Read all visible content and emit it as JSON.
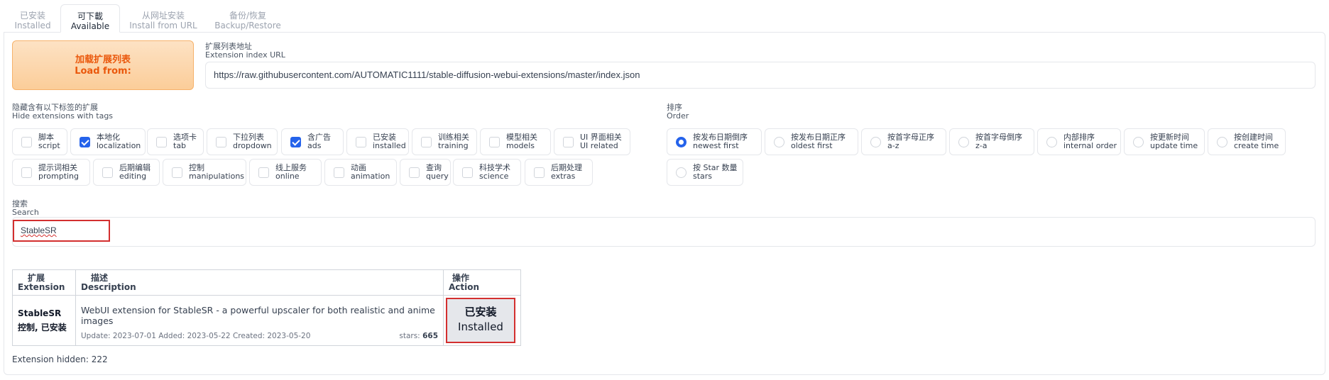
{
  "tabs": [
    {
      "zh": "已安装",
      "en": "Installed"
    },
    {
      "zh": "可下載",
      "en": "Available"
    },
    {
      "zh": "从网址安装",
      "en": "Install from URL"
    },
    {
      "zh": "备份/恢复",
      "en": "Backup/Restore"
    }
  ],
  "load_button": {
    "zh": "加载扩展列表",
    "en": "Load from:"
  },
  "index_url": {
    "label_zh": "扩展列表地址",
    "label_en": "Extension index URL",
    "value": "https://raw.githubusercontent.com/AUTOMATIC1111/stable-diffusion-webui-extensions/master/index.json"
  },
  "hide_tags": {
    "label_zh": "隐藏含有以下标签的扩展",
    "label_en": "Hide extensions with tags",
    "items": [
      {
        "zh": "脚本",
        "en": "script",
        "checked": false
      },
      {
        "zh": "本地化",
        "en": "localization",
        "checked": true
      },
      {
        "zh": "选项卡",
        "en": "tab",
        "checked": false
      },
      {
        "zh": "下拉列表",
        "en": "dropdown",
        "checked": false
      },
      {
        "zh": "含广告",
        "en": "ads",
        "checked": true
      },
      {
        "zh": "已安装",
        "en": "installed",
        "checked": false
      },
      {
        "zh": "训练相关",
        "en": "training",
        "checked": false
      },
      {
        "zh": "模型相关",
        "en": "models",
        "checked": false
      },
      {
        "zh": "UI 界面相关",
        "en": "UI related",
        "checked": false
      },
      {
        "zh": "提示词相关",
        "en": "prompting",
        "checked": false
      },
      {
        "zh": "后期编辑",
        "en": "editing",
        "checked": false
      },
      {
        "zh": "控制",
        "en": "manipulations",
        "checked": false
      },
      {
        "zh": "线上服务",
        "en": "online",
        "checked": false
      },
      {
        "zh": "动画",
        "en": "animation",
        "checked": false
      },
      {
        "zh": "查询",
        "en": "query",
        "checked": false
      },
      {
        "zh": "科技学术",
        "en": "science",
        "checked": false
      },
      {
        "zh": "后期处理",
        "en": "extras",
        "checked": false
      }
    ]
  },
  "order": {
    "label_zh": "排序",
    "label_en": "Order",
    "items": [
      {
        "zh": "按发布日期倒序",
        "en": "newest first",
        "selected": true
      },
      {
        "zh": "按发布日期正序",
        "en": "oldest first",
        "selected": false
      },
      {
        "zh": "按首字母正序",
        "en": "a-z",
        "selected": false
      },
      {
        "zh": "按首字母倒序",
        "en": "z-a",
        "selected": false
      },
      {
        "zh": "内部排序",
        "en": "internal order",
        "selected": false
      },
      {
        "zh": "按更新时间",
        "en": "update time",
        "selected": false
      },
      {
        "zh": "按创建时间",
        "en": "create time",
        "selected": false
      },
      {
        "zh": "按 Star 数量",
        "en": "stars",
        "selected": false
      }
    ]
  },
  "search": {
    "label_zh": "搜索",
    "label_en": "Search",
    "value": "StableSR"
  },
  "table": {
    "headers": [
      {
        "zh": "扩展",
        "en": "Extension"
      },
      {
        "zh": "描述",
        "en": "Description"
      },
      {
        "zh": "操作",
        "en": "Action"
      }
    ],
    "rows": [
      {
        "name": "StableSR",
        "tags": "控制, 已安装",
        "description": "WebUI extension for StableSR - a powerful upscaler for both realistic and anime images",
        "meta": "Update: 2023-07-01 Added: 2023-05-22 Created: 2023-05-20",
        "stars_label": "stars:",
        "stars": "665",
        "action_zh": "已安装",
        "action_en": "Installed"
      }
    ]
  },
  "hidden_text": "Extension hidden: 222"
}
